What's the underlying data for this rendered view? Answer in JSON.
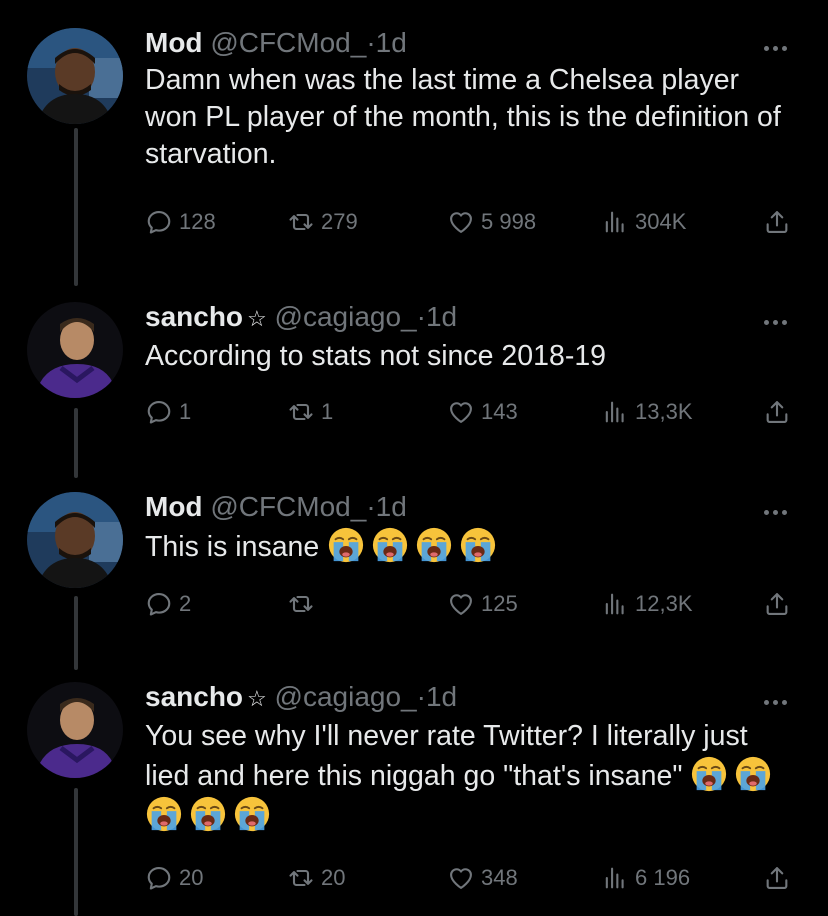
{
  "tweets": [
    {
      "name": "Mod",
      "verified_star": "",
      "handle": "@CFCMod_",
      "separator": "·",
      "time": "1d",
      "text": "Damn when was the last time a Chelsea player won PL player of the month, this is the definition of starvation.",
      "emojis": [],
      "replies": "128",
      "retweets": "279",
      "likes": "5 998",
      "views": "304K",
      "avatar": "man-portrait-avatar"
    },
    {
      "name": "sancho",
      "verified_star": "☆",
      "handle": "@cagiago_",
      "separator": "·",
      "time": "1d",
      "text": "According to stats not since 2018-19",
      "emojis": [],
      "replies": "1",
      "retweets": "1",
      "likes": "143",
      "views": "13,3K",
      "avatar": "footballer-purple-kit-avatar"
    },
    {
      "name": "Mod",
      "verified_star": "",
      "handle": "@CFCMod_",
      "separator": "·",
      "time": "1d",
      "text": "This is insane",
      "emojis": [
        "loudly-crying-face",
        "loudly-crying-face",
        "loudly-crying-face",
        "loudly-crying-face"
      ],
      "replies": "2",
      "retweets": "",
      "likes": "125",
      "views": "12,3K",
      "avatar": "man-portrait-avatar"
    },
    {
      "name": "sancho",
      "verified_star": "☆",
      "handle": "@cagiago_",
      "separator": "·",
      "time": "1d",
      "text": "You see why I'll never rate Twitter? I literally just lied and here this niggah go \"that's insane\"",
      "emojis": [
        "loudly-crying-face",
        "loudly-crying-face",
        "loudly-crying-face",
        "loudly-crying-face",
        "loudly-crying-face"
      ],
      "replies": "20",
      "retweets": "20",
      "likes": "348",
      "views": "6 196",
      "avatar": "footballer-purple-kit-avatar"
    }
  ],
  "colors": {
    "background": "#000000",
    "primary_text": "#e7e9ea",
    "secondary_text": "#71767b",
    "thread_line": "#333639"
  },
  "icons": [
    "reply-icon",
    "retweet-icon",
    "like-icon",
    "views-icon",
    "share-icon",
    "more-icon"
  ]
}
